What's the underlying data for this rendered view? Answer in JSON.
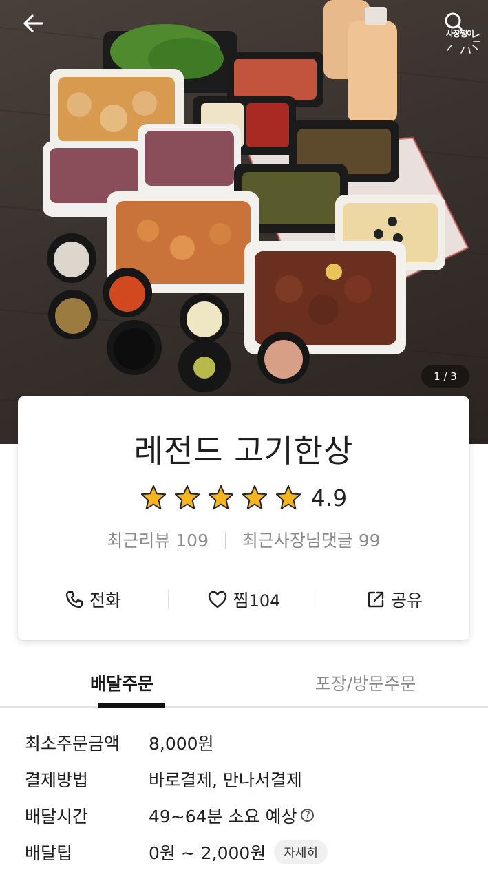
{
  "header": {
    "back_icon": "arrow-left-icon",
    "sticker_label": "사장쨍이"
  },
  "hero": {
    "page_indicator": "1 / 3"
  },
  "store": {
    "name": "레전드 고기한상",
    "rating": "4.9",
    "stars_filled": 5,
    "star_color": "#f6b51e",
    "recent_reviews": "최근리뷰 109",
    "recent_owner_comments": "최근사장님댓글 99"
  },
  "actions": {
    "call": {
      "label": "전화",
      "icon": "phone-icon"
    },
    "like": {
      "label": "찜",
      "count": "104",
      "icon": "heart-icon"
    },
    "share": {
      "label": "공유",
      "icon": "share-icon"
    }
  },
  "tabs": [
    {
      "label": "배달주문",
      "active": true
    },
    {
      "label": "포장/방문주문",
      "active": false
    }
  ],
  "info": [
    {
      "label": "최소주문금액",
      "value": "8,000원"
    },
    {
      "label": "결제방법",
      "value": "바로결제, 만나서결제"
    },
    {
      "label": "배달시간",
      "value": "49~64분 소요 예상",
      "help": "?"
    },
    {
      "label": "배달팁",
      "value": "0원 ~ 2,000원",
      "button": "자세히"
    }
  ]
}
